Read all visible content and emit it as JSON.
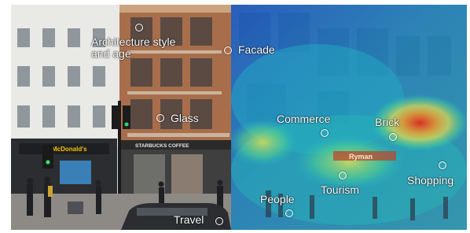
{
  "left_scene": {
    "shop_signs": [
      "McDonald's",
      "STARBUCKS COFFEE"
    ]
  },
  "right_scene": {
    "shop_sign": "Ryman",
    "heatmap_colors": [
      "#1f5fd6",
      "#16b8c8",
      "#44d08a",
      "#e7e04a",
      "#e83a2a"
    ]
  },
  "annotations": [
    {
      "id": "architecture",
      "label": "Architecture style and age"
    },
    {
      "id": "facade",
      "label": "Facade"
    },
    {
      "id": "glass",
      "label": "Glass"
    },
    {
      "id": "commerce",
      "label": "Commerce"
    },
    {
      "id": "brick",
      "label": "Brick"
    },
    {
      "id": "people",
      "label": "People"
    },
    {
      "id": "tourism",
      "label": "Tourism"
    },
    {
      "id": "shopping",
      "label": "Shopping"
    },
    {
      "id": "travel",
      "label": "Travel"
    }
  ],
  "icons": {
    "marker": "circle-marker-icon"
  }
}
